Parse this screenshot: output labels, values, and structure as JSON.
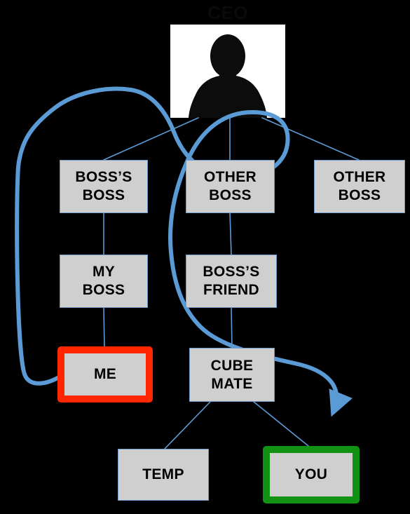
{
  "chart": {
    "type": "org-chart",
    "title": "CEO",
    "background_color": "#000000",
    "node_fill": "#cfcfcf",
    "node_border": "#6f9ac9",
    "connector_color": "#5b9bd5",
    "highlight_red": "#ff2600",
    "highlight_green": "#129212"
  },
  "photo": {
    "name": "ceo-silhouette-photo",
    "alt": "silhouette portrait"
  },
  "nodes": {
    "bosss_boss": {
      "line1": "BOSS’S",
      "line2": "BOSS"
    },
    "other_boss_mid": {
      "line1": "OTHER",
      "line2": "BOSS"
    },
    "other_boss_right": {
      "line1": "OTHER",
      "line2": "BOSS"
    },
    "my_boss": {
      "line1": "MY",
      "line2": "BOSS"
    },
    "bosss_friend": {
      "line1": "BOSS’S",
      "line2": "FRIEND"
    },
    "me": {
      "line1": "ME",
      "line2": ""
    },
    "cube_mate": {
      "line1": "CUBE",
      "line2": "MATE"
    },
    "temp": {
      "line1": "TEMP",
      "line2": ""
    },
    "you": {
      "line1": "YOU",
      "line2": ""
    }
  },
  "relationships": [
    {
      "from": "CEO",
      "to": "BOSS’S BOSS",
      "style": "thin"
    },
    {
      "from": "CEO",
      "to": "OTHER BOSS",
      "style": "thin"
    },
    {
      "from": "CEO",
      "to": "OTHER BOSS",
      "style": "thin"
    },
    {
      "from": "BOSS’S BOSS",
      "to": "MY BOSS",
      "style": "thin"
    },
    {
      "from": "OTHER BOSS",
      "to": "BOSS’S FRIEND",
      "style": "thin"
    },
    {
      "from": "MY BOSS",
      "to": "ME",
      "style": "thin"
    },
    {
      "from": "BOSS’S FRIEND",
      "to": "CUBE MATE",
      "style": "thin"
    },
    {
      "from": "CUBE MATE",
      "to": "TEMP",
      "style": "thin"
    },
    {
      "from": "CUBE MATE",
      "to": "YOU",
      "style": "thin"
    },
    {
      "from": "ME",
      "to": "YOU",
      "style": "thick-curved-arrow"
    }
  ]
}
